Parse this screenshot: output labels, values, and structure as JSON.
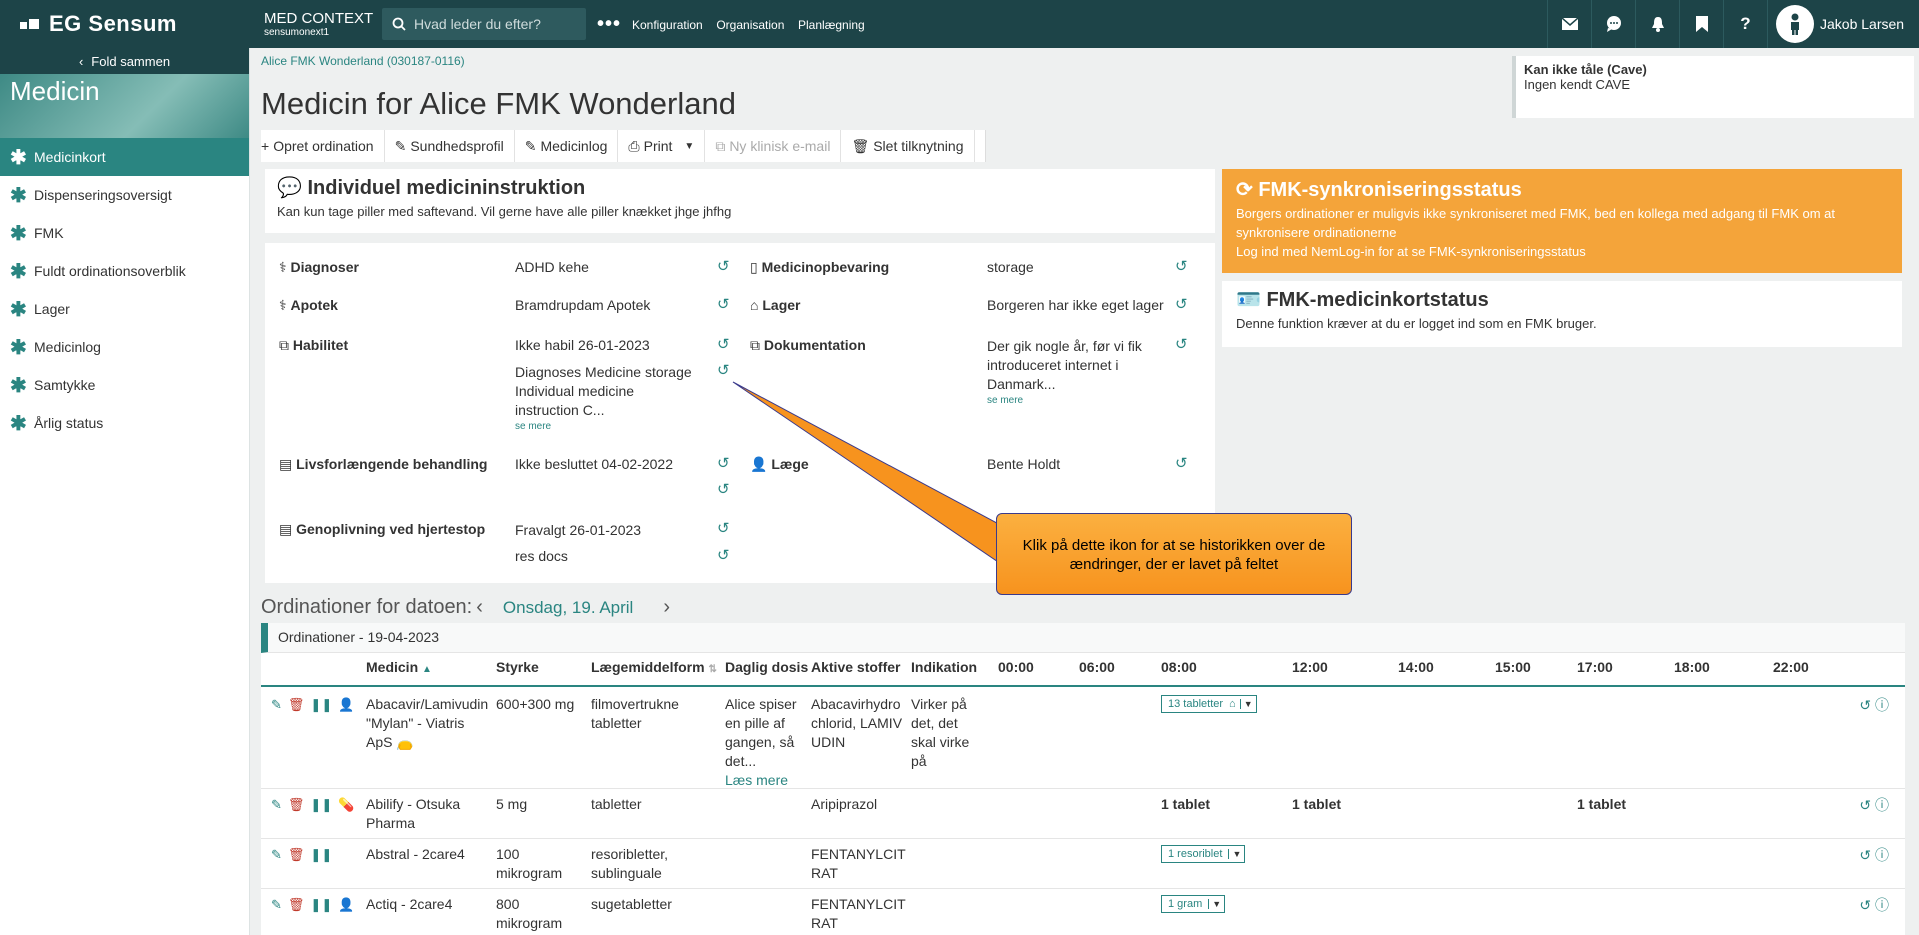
{
  "brand": "EG Sensum",
  "context": {
    "title": "MED CONTEXT",
    "sub": "sensumonext1"
  },
  "search": {
    "placeholder": "Hvad leder du efter?"
  },
  "nav": [
    "Konfiguration",
    "Organisation",
    "Planlægning"
  ],
  "user": {
    "name": "Jakob Larsen"
  },
  "sidebar": {
    "fold": "Fold sammen",
    "title": "Medicin",
    "items": [
      "Medicinkort",
      "Dispenseringsoversigt",
      "FMK",
      "Fuldt ordinationsoverblik",
      "Lager",
      "Medicinlog",
      "Samtykke",
      "Årlig status"
    ]
  },
  "breadcrumb": "Alice FMK Wonderland (030187-0116)",
  "page_title": "Medicin for Alice FMK Wonderland",
  "cave": {
    "title": "Kan ikke tåle (Cave)",
    "text": "Ingen kendt CAVE"
  },
  "toolbar": {
    "create": "Opret ordination",
    "health": "Sundhedsprofil",
    "log": "Medicinlog",
    "print": "Print",
    "email": "Ny klinisk e-mail",
    "delete": "Slet tilknytning"
  },
  "instruction": {
    "title": "Individuel medicininstruktion",
    "text": "Kan kun tage piller med saftevand. Vil gerne have alle piller knækket jhge jhfhg"
  },
  "details": {
    "diag_l": "Diagnoser",
    "diag_v": "ADHD kehe",
    "stor_l": "Medicinopbevaring",
    "stor_v": "storage",
    "apo_l": "Apotek",
    "apo_v": "Bramdrupdam Apotek",
    "lager_l": "Lager",
    "lager_v": "Borgeren har ikke eget lager",
    "hab_l": "Habilitet",
    "hab_v1": "Ikke habil 26-01-2023",
    "hab_v2": "Diagnoses Medicine storage Individual medicine instruction C...",
    "dok_l": "Dokumentation",
    "dok_v": "Der gik nogle år, før vi fik introduceret internet i Danmark...",
    "more": "se mere",
    "liv_l": "Livsforlængende behandling",
    "liv_v": "Ikke besluttet 04-02-2022",
    "laege_l": "Læge",
    "laege_v": "Bente Holdt",
    "gen_l": "Genoplivning ved hjertestop",
    "gen_v1": "Fravalgt 26-01-2023",
    "gen_v2": "res docs"
  },
  "sync": {
    "title": "FMK-synkroniseringsstatus",
    "l1": "Borgers ordinationer er muligvis ikke synkroniseret med FMK, bed en kollega med adgang til FMK om at",
    "l2": "synkronisere ordinationerne",
    "l3": "Log ind med NemLog-in for at se FMK-synkroniseringsstatus"
  },
  "fmk": {
    "title": "FMK-medicinkortstatus",
    "text": "Denne funktion kræver at du er logget ind som en FMK bruger."
  },
  "orders": {
    "heading": "Ordinationer for datoen:",
    "date": "Onsdag, 19. April",
    "box_title": "Ordinationer - 19-04-2023",
    "cols": [
      "Medicin",
      "Styrke",
      "Lægemiddelform",
      "Daglig dosis",
      "Aktive stoffer",
      "Indikation",
      "00:00",
      "06:00",
      "08:00",
      "12:00",
      "14:00",
      "15:00",
      "17:00",
      "18:00",
      "22:00"
    ],
    "rows": [
      {
        "med": "Abacavir/Lamivudin \"Mylan\" - Viatris ApS",
        "str": "600+300 mg",
        "form": "filmovertrukne tabletter",
        "dose": "Alice spiser en pille af gangen, så det...",
        "dose_more": "Læs mere",
        "act": "Abacavirhydrochlorid, LAMIVUDIN",
        "ind": "Virker på det, det skal virke på",
        "pill": "13 tabletter"
      },
      {
        "med": "Abilify - Otsuka Pharma",
        "str": "5 mg",
        "form": "tabletter",
        "act": "Aripiprazol",
        "t08": "1 tablet",
        "t12": "1 tablet",
        "t17": "1 tablet"
      },
      {
        "med": "Abstral - 2care4",
        "str": "100 mikrogram",
        "form": "resoribletter, sublinguale",
        "act": "FENTANYLCITRAT",
        "pill": "1 resoriblet"
      },
      {
        "med": "Actiq - 2care4",
        "str": "800 mikrogram",
        "form": "sugetabletter",
        "act": "FENTANYLCITRAT",
        "pill": "1 gram"
      }
    ]
  },
  "callout": "Klik på dette ikon for at se historikken over de ændringer, der er lavet på feltet"
}
